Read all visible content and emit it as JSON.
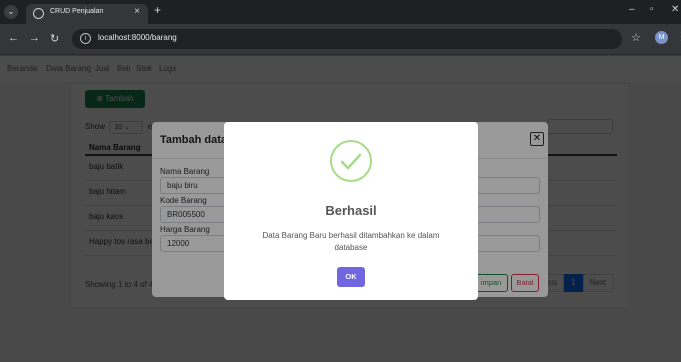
{
  "browser": {
    "tab_title": "CRUD Penjualan",
    "tab_close": "×",
    "new_tab": "+",
    "url": "localhost:8000/barang",
    "profile_initial": "M",
    "icons": [
      "tab-menu-icon",
      "favicon-icon",
      "back-icon",
      "forward-icon",
      "reload-icon",
      "site-info-icon",
      "bookmark-star-icon",
      "profile-icon",
      "menu-kebab-icon",
      "minimize-icon",
      "maximize-icon",
      "close-window-icon"
    ]
  },
  "nav": {
    "links": [
      "Beranda",
      "Data Barang",
      "Jual",
      "Beli",
      "Stok",
      "Logs"
    ]
  },
  "card": {
    "add_button": "Tambah",
    "show_label": "Show",
    "show_value": "10",
    "entries_label": "ent",
    "table": {
      "header": "Nama Barang",
      "rows": [
        "baju batik",
        "baju hitam",
        "baju kaos",
        "Happy tos rasa bar"
      ]
    },
    "footer_info": "Showing 1 to 4 of 4",
    "pager": {
      "previous": "vious",
      "page": "1",
      "next": "Next"
    }
  },
  "form_modal": {
    "title": "Tambah data I",
    "close": "✕",
    "fields": [
      {
        "label": "Nama Barang",
        "value": "baju biru"
      },
      {
        "label": "Kode Barang",
        "value": "BR005500"
      },
      {
        "label": "Harga Barang",
        "value": "12000"
      }
    ],
    "save_button": "impan",
    "cancel_button": "Batal"
  },
  "alert": {
    "title": "Berhasil",
    "message": "Data Barang Baru berhasil ditambahkan ke dalam database",
    "ok_button": "OK",
    "success_color": "#a5dc86",
    "ok_color": "#7066e0"
  }
}
